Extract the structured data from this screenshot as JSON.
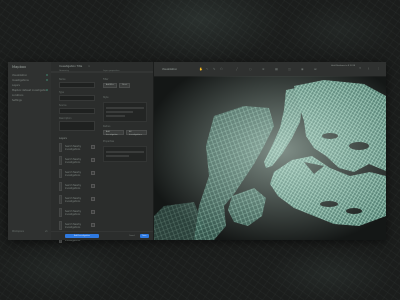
{
  "window": {
    "app_name": "Mapbox",
    "panel_title": "Investigation Title",
    "map_title": "Visualization",
    "user_label": "Hold Rainbow to 8 2018"
  },
  "sidebar": {
    "items": [
      {
        "label": "Visualization"
      },
      {
        "label": "Investigations"
      },
      {
        "label": "Layers"
      },
      {
        "label": "Mapbox dataset investigation"
      },
      {
        "label": "Locations"
      },
      {
        "label": "Settings"
      }
    ],
    "footer_left": "Workspace",
    "footer_right": "v1"
  },
  "panel": {
    "strip_left": "Geometry",
    "strip_right": "Layer properties",
    "fields": [
      {
        "label": "Name",
        "value": ""
      },
      {
        "label": "Type",
        "value": ""
      },
      {
        "label": "Source",
        "value": ""
      },
      {
        "label": "Description",
        "value": ""
      }
    ],
    "list_heading": "Layers",
    "list_items": [
      "Search Nearby Investigations",
      "Search Nearby Investigations",
      "Search Nearby Investigations",
      "Search Nearby Investigations",
      "Search Nearby Investigations",
      "Search Nearby Investigations",
      "Search Nearby Investigations",
      "Search Nearby Investigations"
    ],
    "right": {
      "label1": "Filter",
      "label2": "Style",
      "label3": "Radius",
      "btn_a": "Add filter",
      "btn_b": "Reset",
      "btn_c": "Add Investigation",
      "btn_d": "All Investigations",
      "block_label": "Properties"
    },
    "footer": {
      "primary": "Add Investigation",
      "cancel": "Cancel",
      "save": "Save"
    }
  },
  "toolbar": {
    "tools": [
      "hand-icon",
      "pointer-icon",
      "pencil-icon",
      "polygon-icon",
      "line-icon",
      "circle-icon",
      "zoom-icon",
      "grid-icon",
      "layers-icon",
      "eye-icon",
      "measure-icon"
    ],
    "right_tools": [
      "share-icon",
      "download-icon",
      "menu-icon"
    ]
  },
  "colors": {
    "accent": "#2e79e0",
    "map_land": "#7fb3a3",
    "map_bg": "#141716",
    "panel": "#2b2d2c"
  }
}
